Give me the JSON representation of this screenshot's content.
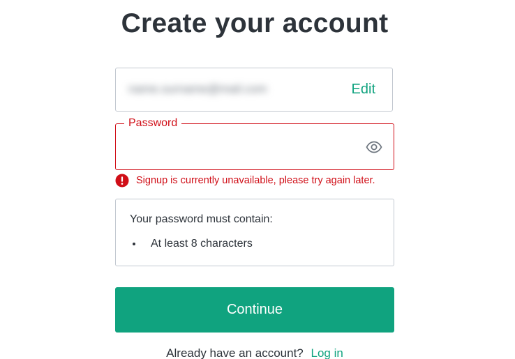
{
  "page": {
    "title": "Create your account"
  },
  "email_field": {
    "value": "name.surname@mail.com",
    "edit_label": "Edit"
  },
  "password_field": {
    "label": "Password",
    "value": ""
  },
  "error": {
    "message": "Signup is currently unavailable, please try again later."
  },
  "requirements": {
    "title": "Your password must contain:",
    "items": [
      "At least 8 characters"
    ]
  },
  "continue_button": {
    "label": "Continue"
  },
  "footer": {
    "prompt": "Already have an account?",
    "login_label": "Log in"
  },
  "colors": {
    "accent": "#10a37f",
    "error": "#d00e17",
    "text": "#2d333a",
    "border": "#c2c8d0"
  },
  "icons": {
    "password_toggle": "eye-icon",
    "error": "error-icon"
  }
}
